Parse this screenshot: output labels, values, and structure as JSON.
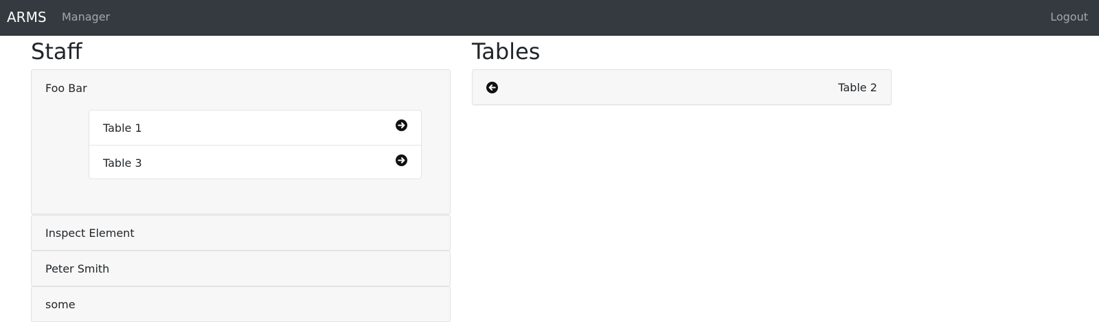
{
  "navbar": {
    "brand": "ARMS",
    "manager_link": "Manager",
    "logout_link": "Logout"
  },
  "staff": {
    "title": "Staff",
    "members": [
      {
        "name": "Foo Bar",
        "tables": [
          {
            "label": "Table 1",
            "icon": "arrow-circle-right-icon"
          },
          {
            "label": "Table 3",
            "icon": "arrow-circle-right-icon"
          }
        ]
      },
      {
        "name": "Inspect Element"
      },
      {
        "name": "Peter Smith"
      },
      {
        "name": "some"
      }
    ]
  },
  "tables": {
    "title": "Tables",
    "items": [
      {
        "label": "Table 2",
        "icon": "arrow-circle-left-icon"
      }
    ]
  },
  "colors": {
    "navbar_bg": "#343a40",
    "card_bg": "#f7f7f7",
    "icon": "#111111"
  }
}
